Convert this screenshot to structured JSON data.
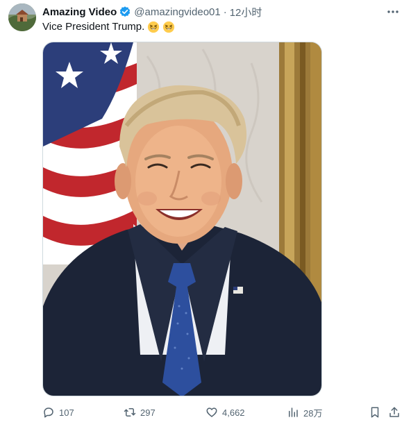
{
  "tweet": {
    "display_name": "Amazing Video",
    "handle": "@amazingvideo01",
    "separator": "·",
    "timestamp": "12小时",
    "text": "Vice President Trump.",
    "emojis": [
      "😆",
      "😆"
    ],
    "verified": true,
    "verified_color": "#1d9bf0"
  },
  "icons": {
    "more": "more-dots-icon",
    "reply": "reply-icon",
    "retweet": "retweet-icon",
    "like": "heart-icon",
    "views": "views-chart-icon",
    "bookmark": "bookmark-icon",
    "share": "share-icon"
  },
  "actions": {
    "reply_count": "107",
    "retweet_count": "297",
    "like_count": "4,662",
    "views_count": "28万"
  },
  "colors": {
    "text_primary": "#0f1419",
    "text_secondary": "#536471",
    "border": "#cfd9de"
  }
}
